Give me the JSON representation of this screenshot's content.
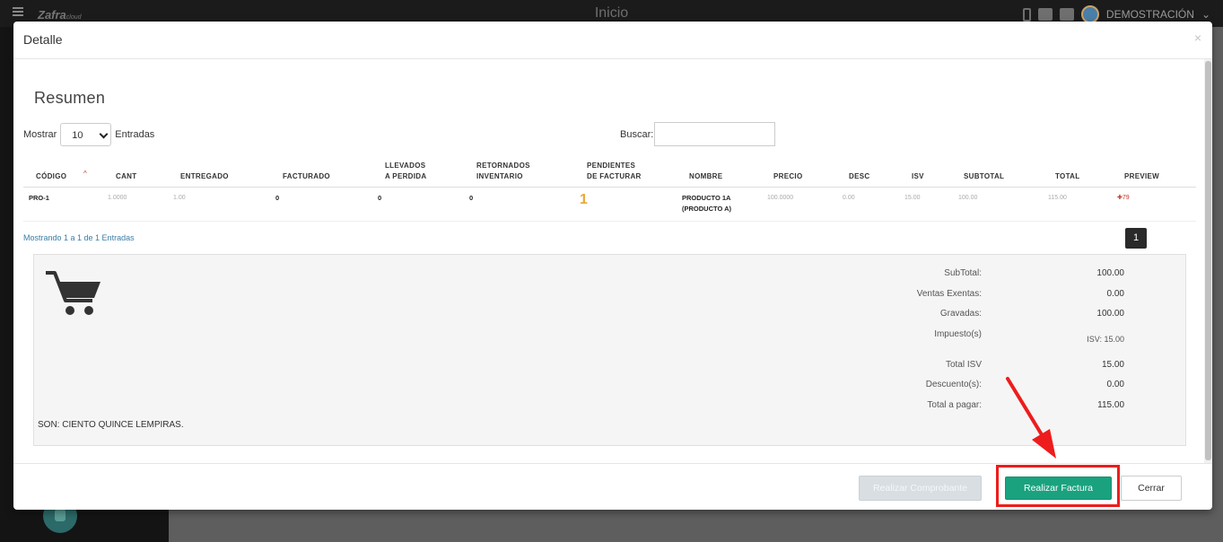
{
  "app": {
    "logo": "Zafra",
    "logo_suffix": "cloud",
    "page_title": "Inicio",
    "user": "DEMOSTRACIÓN"
  },
  "modal": {
    "title": "Detalle",
    "close_icon": "×",
    "section_title": "Resumen"
  },
  "table_controls": {
    "show_label": "Mostrar",
    "length_value": "10",
    "entries_label": "Entradas",
    "search_label": "Buscar:"
  },
  "table": {
    "headers": [
      "CÓDIGO",
      "CANT",
      "ENTREGADO",
      "FACTURADO",
      "LLEVADOS\nA PERDIDA",
      "RETORNADOS\nINVENTARIO",
      "PENDIENTES\nDE FACTURAR",
      "NOMBRE",
      "PRECIO",
      "DESC",
      "ISV",
      "SUBTOTAL",
      "TOTAL",
      "PREVIEW"
    ],
    "rows": [
      {
        "codigo": "PRO-1",
        "cant": "1.0000",
        "entregado": "1.00",
        "facturado": "0",
        "perdida": "0",
        "retornados": "0",
        "pendientes": "1",
        "nombre": "PRODUCTO 1A\n(PRODUCTO A)",
        "precio": "100.0000",
        "desc": "0.00",
        "isv": "15.00",
        "subtotal": "100.00",
        "total": "115.00",
        "preview": "79"
      }
    ],
    "info": "Mostrando 1 a 1 de 1 Entradas",
    "current_page": "1"
  },
  "summary": {
    "subtotal_label": "SubTotal:",
    "subtotal": "100.00",
    "exentas_label": "Ventas Exentas:",
    "exentas": "0.00",
    "gravadas_label": "Gravadas:",
    "gravadas": "100.00",
    "impuesto_label": "Impuesto(s)",
    "impuesto": "ISV: 15.00",
    "total_isv_label": "Total ISV",
    "total_isv": "15.00",
    "descuento_label": "Descuento(s):",
    "descuento": "0.00",
    "total_label": "Total a pagar:",
    "total": "115.00",
    "amount_words": "SON: CIENTO QUINCE LEMPIRAS."
  },
  "footer": {
    "comprobante_label": "Realizar Comprobante",
    "factura_label": "Realizar Factura",
    "cerrar_label": "Cerrar"
  },
  "colors": {
    "primary_button": "#1aa27f",
    "annotation": "#ee1c1c",
    "pending_value": "#e8a837"
  }
}
